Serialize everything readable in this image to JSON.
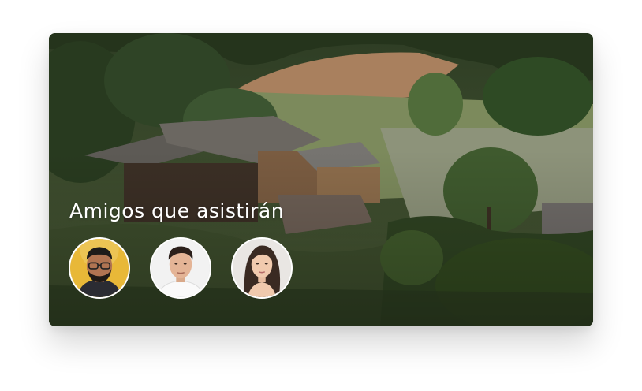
{
  "card": {
    "title": "Amigos que asistirán",
    "friends": [
      {
        "avatar_icon": "person-glasses-beard-avatar",
        "background": "#e8b838"
      },
      {
        "avatar_icon": "person-young-man-avatar",
        "background": "#f2f2f2"
      },
      {
        "avatar_icon": "person-long-hair-woman-avatar",
        "background": "#e9e6e3"
      }
    ]
  }
}
